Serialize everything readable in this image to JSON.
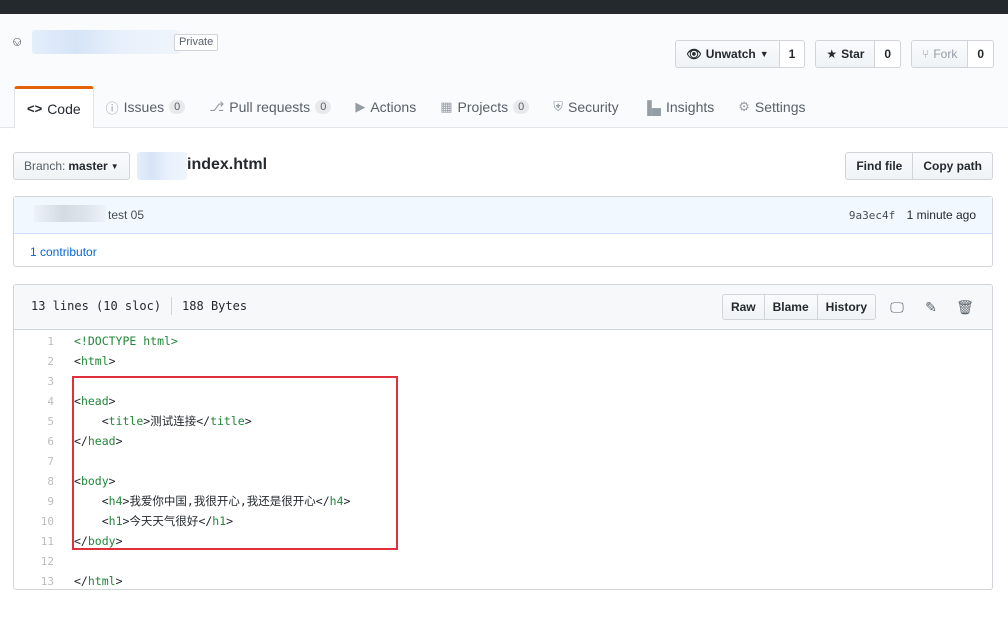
{
  "repo": {
    "visibility_label": "Private",
    "icon": "repo-icon"
  },
  "actions": {
    "watch_label": "Unwatch",
    "watch_count": "1",
    "star_label": "Star",
    "star_count": "0",
    "fork_label": "Fork",
    "fork_count": "0"
  },
  "tabs": [
    {
      "label": "Code",
      "icon": "code-icon",
      "count": ""
    },
    {
      "label": "Issues",
      "icon": "issue-icon",
      "count": "0"
    },
    {
      "label": "Pull requests",
      "icon": "pull-request-icon",
      "count": "0"
    },
    {
      "label": "Actions",
      "icon": "play-icon",
      "count": ""
    },
    {
      "label": "Projects",
      "icon": "project-icon",
      "count": "0"
    },
    {
      "label": "Security",
      "icon": "shield-icon",
      "count": ""
    },
    {
      "label": "Insights",
      "icon": "graph-icon",
      "count": ""
    },
    {
      "label": "Settings",
      "icon": "gear-icon",
      "count": ""
    }
  ],
  "branch": {
    "prefix": "Branch:",
    "name": "master"
  },
  "file": {
    "name": "index.html",
    "find_label": "Find file",
    "copy_label": "Copy path",
    "lines_info": "13 lines (10 sloc)",
    "size": "188 Bytes",
    "raw_label": "Raw",
    "blame_label": "Blame",
    "history_label": "History"
  },
  "commit": {
    "message": "test 05",
    "sha": "9a3ec4f",
    "time": "1 minute ago",
    "contributors": "1 contributor"
  },
  "code_lines": [
    {
      "n": "1",
      "text": "<!DOCTYPE html>"
    },
    {
      "n": "2",
      "text": "<html>"
    },
    {
      "n": "3",
      "text": ""
    },
    {
      "n": "4",
      "text": "<head>"
    },
    {
      "n": "5",
      "text": "    <title>测试连接</title>"
    },
    {
      "n": "6",
      "text": "</head>"
    },
    {
      "n": "7",
      "text": ""
    },
    {
      "n": "8",
      "text": "<body>"
    },
    {
      "n": "9",
      "text": "    <h4>我爱你中国,我很开心,我还是很开心</h4>"
    },
    {
      "n": "10",
      "text": "    <h1>今天天气很好</h1>"
    },
    {
      "n": "11",
      "text": "</body>"
    },
    {
      "n": "12",
      "text": ""
    },
    {
      "n": "13",
      "text": "</html>"
    }
  ],
  "colors": {
    "accent_tab": "#e36209",
    "highlight_box": "#e0313a",
    "link": "#0366d6"
  }
}
